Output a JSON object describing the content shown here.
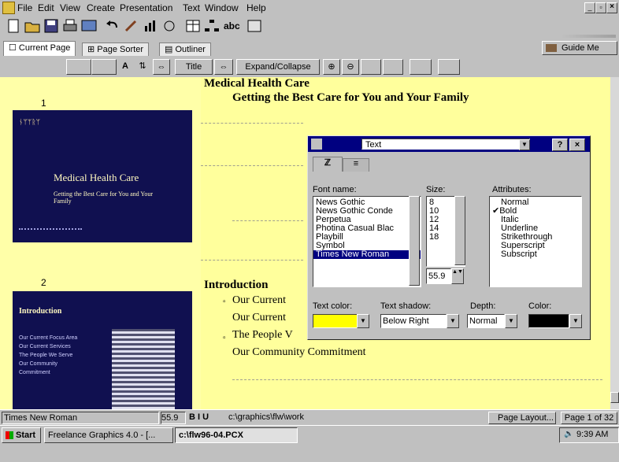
{
  "menubar": {
    "items": [
      "File",
      "Edit",
      "View",
      "Create",
      "Presentation",
      "Text",
      "Window",
      "Help"
    ],
    "window_controls": [
      "_",
      "▫",
      "×"
    ]
  },
  "toolbar": {
    "abc_label": "abc"
  },
  "tabs": {
    "items": [
      "Current Page",
      "Page Sorter",
      "Outliner"
    ],
    "guide_label": "Guide Me"
  },
  "outliner_toolbar": {
    "title_label": "Title",
    "expand_label": "Expand/Collapse"
  },
  "slides": [
    {
      "number": "1",
      "title": "Medical Health Care",
      "subtitle": "Getting the Best Care for You and Your Family",
      "thumb_title": "Medical Health Care",
      "thumb_subtitle": "Getting the Best Care for You and Your Family"
    },
    {
      "number": "2",
      "title": "Introduction",
      "thumb_title": "Introduction",
      "bullets": [
        "Our Current",
        "Our Current",
        "The People V",
        "Our Community Commitment"
      ],
      "thumb_bullets": [
        "Our Current Focus Area",
        "Our Current Services",
        "The People We Serve",
        "Our Community Commitment"
      ]
    }
  ],
  "dialog": {
    "title": "Text",
    "help": "?",
    "font_label": "Font name:",
    "size_label": "Size:",
    "attributes_label": "Attributes:",
    "fonts": [
      "News Gothic",
      "News Gothic Conde",
      "Perpetua",
      "Photina Casual Blac",
      "Playbill",
      "Symbol",
      "Times New Roman"
    ],
    "selected_font": "Times New Roman",
    "sizes": [
      "8",
      "10",
      "12",
      "14",
      "18"
    ],
    "size_value": "55.9",
    "attributes": [
      "Normal",
      "Bold",
      "Italic",
      "Underline",
      "Strikethrough",
      "Superscript",
      "Subscript"
    ],
    "checked_attribute": "Bold",
    "text_color_label": "Text color:",
    "text_shadow_label": "Text shadow:",
    "depth_label": "Depth:",
    "color_label": "Color:",
    "text_color": "#ffff00",
    "shadow_value": "Below Right",
    "depth_value": "Normal",
    "shadow_color": "#000000"
  },
  "statusbar": {
    "font": "Times New Roman",
    "size": "55.9",
    "style": "B I U",
    "path": "c:\\graphics\\flw\\work",
    "layout": "Page Layout...",
    "page": "Page 1 of 32"
  },
  "taskbar": {
    "start": "Start",
    "task1": "Freelance Graphics 4.0 - [...",
    "task2": "c:\\flw96-04.PCX",
    "clock": "9:39 AM"
  },
  "colors": {
    "outline_bg": "#ffff9c",
    "slide_bg": "#101050",
    "selection": "#000080"
  }
}
